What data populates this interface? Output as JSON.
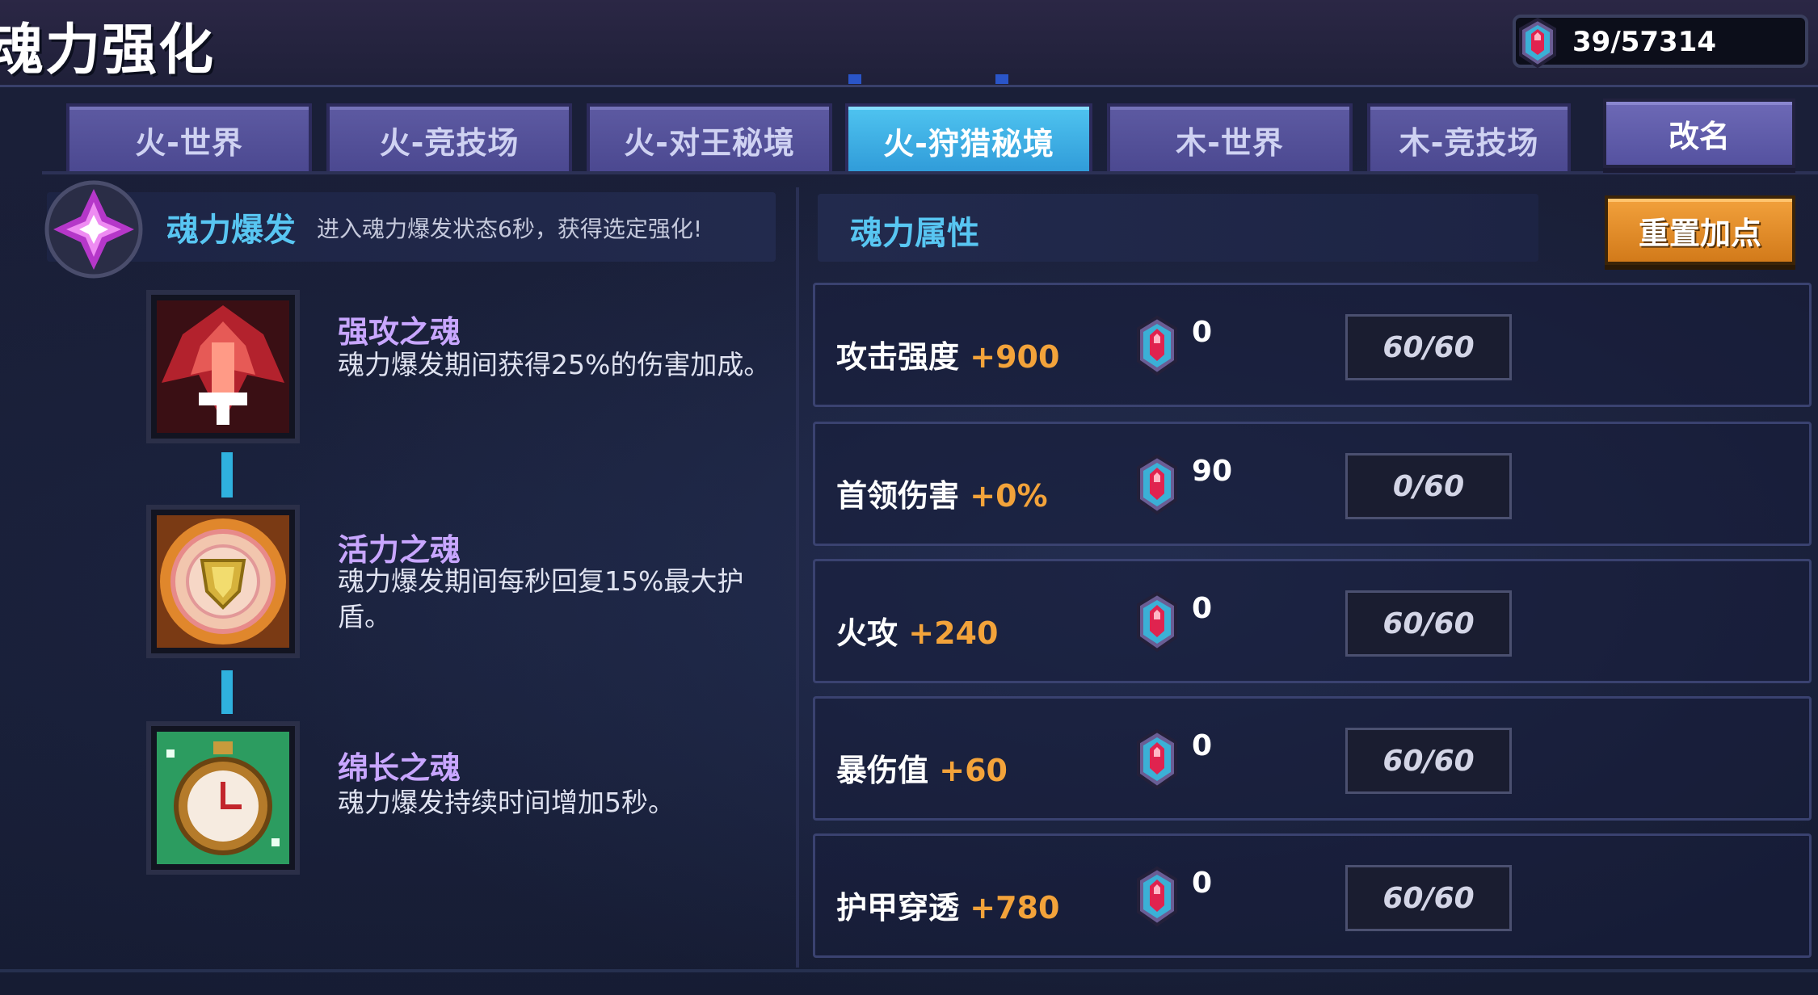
{
  "header": {
    "title": "魂力强化",
    "currency": "39/57314",
    "currency_icon": "soul-gem-icon"
  },
  "tabs": [
    {
      "label": "火-世界",
      "active": false
    },
    {
      "label": "火-竞技场",
      "active": false
    },
    {
      "label": "火-对王秘境",
      "active": false
    },
    {
      "label": "火-狩猎秘境",
      "active": true
    },
    {
      "label": "木-世界",
      "active": false
    },
    {
      "label": "木-竞技场",
      "active": false
    }
  ],
  "rename_button": "改名",
  "burst": {
    "title": "魂力爆发",
    "description": "进入魂力爆发状态6秒，获得选定强化!"
  },
  "souls": [
    {
      "name": "强攻之魂",
      "desc": "魂力爆发期间获得25%的伤害加成。",
      "icon": "red-crest-icon"
    },
    {
      "name": "活力之魂",
      "desc": "魂力爆发期间每秒回复15%最大护盾。",
      "icon": "shield-medallion-icon"
    },
    {
      "name": "绵长之魂",
      "desc": "魂力爆发持续时间增加5秒。",
      "icon": "stopwatch-icon"
    }
  ],
  "attributes": {
    "title": "魂力属性",
    "reset_button": "重置加点",
    "rows": [
      {
        "name": "攻击强度",
        "bonus": "+900",
        "cost": "0",
        "progress": "60/60"
      },
      {
        "name": "首领伤害",
        "bonus": "+0%",
        "cost": "90",
        "progress": "0/60"
      },
      {
        "name": "火攻",
        "bonus": "+240",
        "cost": "0",
        "progress": "60/60"
      },
      {
        "name": "暴伤值",
        "bonus": "+60",
        "cost": "0",
        "progress": "60/60"
      },
      {
        "name": "护甲穿透",
        "bonus": "+780",
        "cost": "0",
        "progress": "60/60"
      }
    ]
  },
  "colors": {
    "accent_blue": "#58c6f2",
    "bonus_orange": "#f3a33a",
    "soul_name_purple": "#c8a6ff",
    "reset_orange": "#e48d28"
  }
}
